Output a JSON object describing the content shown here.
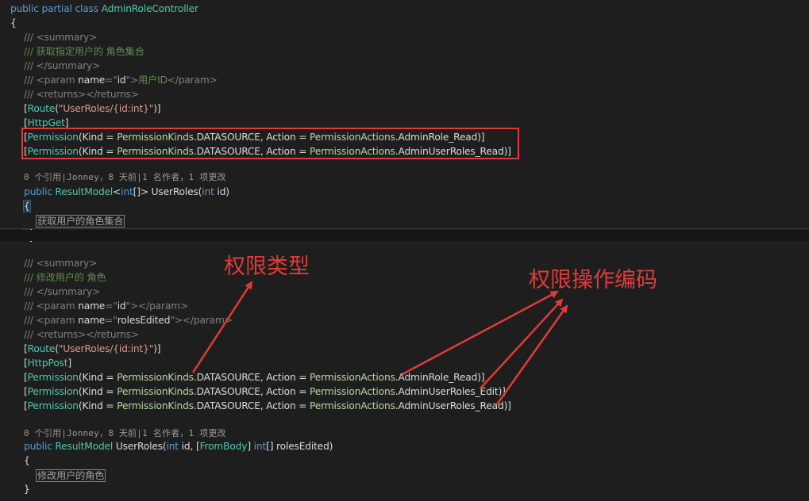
{
  "code": {
    "class_decl": {
      "kw1": "public",
      "kw2": "partial",
      "kw3": "class",
      "name": "AdminRoleController"
    },
    "open_brace": "{",
    "close_brace": "}",
    "method1": {
      "doc_summary_open": "/// <summary>",
      "doc_summary_text": "/// 获取指定用户的 角色集合",
      "doc_summary_close": "/// </summary>",
      "doc_param": {
        "prefix": "/// ",
        "tag_open": "<param ",
        "attr": "name",
        "eq": "=\"",
        "value": "id",
        "quote": "\"",
        "gt": ">",
        "text": "用户ID",
        "tag_close": "</param>"
      },
      "doc_returns": "/// <returns></returns>",
      "route": {
        "attr": "Route",
        "arg": "\"UserRoles/{id:int}\""
      },
      "http": "HttpGet",
      "perm_read": {
        "attr": "Permission",
        "pre": "(Kind = ",
        "kinds": "PermissionKinds",
        "mid1": ".DATASOURCE, Action = ",
        "actions": "PermissionActions",
        "action": ".AdminRole_Read",
        "end": ")]"
      },
      "perm_userroles": {
        "action": ".AdminUserRoles_Read"
      },
      "codelens": "0 个引用|Jonney，8 天前|1 名作者，1 项更改",
      "signature": {
        "kw": "public",
        "type": "ResultModel",
        "generic_open": "<",
        "int": "int",
        "generic_close": "[]>",
        "name": " UserRoles(",
        "param_type": "int",
        "param": " id)"
      },
      "collapsed": "获取用户的角色集合"
    },
    "method2": {
      "doc_summary_open": "/// <summary>",
      "doc_summary_text": "/// 修改用户的 角色",
      "doc_summary_close": "/// </summary>",
      "doc_param1": {
        "value": "id"
      },
      "doc_param2": {
        "value": "rolesEdited"
      },
      "doc_returns": "/// <returns></returns>",
      "route": {
        "arg": "\"UserRoles/{id:int}\""
      },
      "http": "HttpPost",
      "perm_actions": [
        ".AdminRole_Read",
        ".AdminUserRoles_Edit",
        ".AdminUserRoles_Read"
      ],
      "codelens": "0 个引用|Jonney，8 天前|1 名作者，1 项更改",
      "signature": {
        "kw": "public",
        "type": "ResultModel",
        "name": " UserRoles(",
        "int": "int",
        "param1": " id, [",
        "frombody": "FromBody",
        "close_br": "] ",
        "int2": "int",
        "param2": "[] rolesEdited)"
      },
      "collapsed": "修改用户的角色"
    }
  },
  "annotations": {
    "kind_label": "权限类型",
    "action_label": "权限操作编码",
    "color": "#e23a3a"
  },
  "colors": {
    "background": "#1e1e1e",
    "keyword": "#569cd6",
    "type": "#4ec9b0",
    "comment": "#57a64a",
    "string": "#d69d85",
    "enum": "#b8d7a3"
  }
}
